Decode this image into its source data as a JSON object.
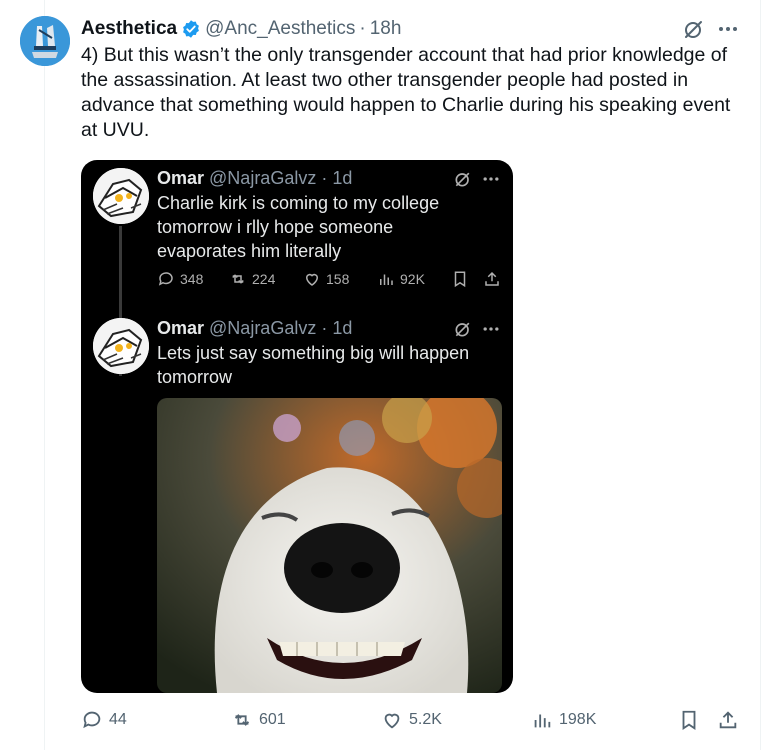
{
  "author": {
    "display_name": "Aesthetica",
    "handle": "@Anc_Aesthetics",
    "separator": "·",
    "time": "18h",
    "verified": true
  },
  "tweet": {
    "text": "4) But this wasn’t the only transgender account that had prior knowledge of\nthe assassination. At least two other transgender people had posted in\nadvance that something would happen to Charlie during his speaking event\nat UVU."
  },
  "embedded": {
    "posts": [
      {
        "name": "Omar",
        "handle": "@NajraGalvz",
        "separator": "·",
        "time": "1d",
        "text": "Charlie kirk is coming to my college\ntomorrow i rlly hope someone\nevaporates him literally",
        "replies": "348",
        "reposts": "224",
        "likes": "158",
        "views": "92K"
      },
      {
        "name": "Omar",
        "handle": "@NajraGalvz",
        "separator": "·",
        "time": "1d",
        "text": "Lets just say something big will happen\ntomorrow"
      }
    ]
  },
  "actions": {
    "replies": "44",
    "reposts": "601",
    "likes": "5.2K",
    "views": "198K"
  },
  "colors": {
    "text": "#0f1419",
    "secondary": "#536471",
    "verified": "#1d9bf0",
    "media_bg": "#000000"
  },
  "icons": [
    "verified-badge-icon",
    "grok-icon",
    "more-icon",
    "reply-icon",
    "repost-icon",
    "like-icon",
    "views-icon",
    "bookmark-icon",
    "share-icon"
  ]
}
